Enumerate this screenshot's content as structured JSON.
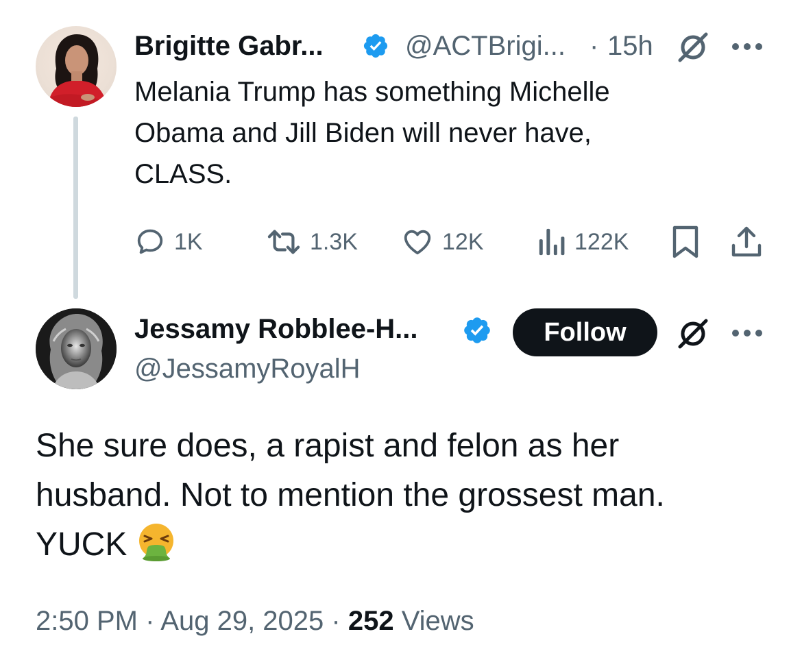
{
  "parent_tweet": {
    "author_name": "Brigitte Gabr...",
    "handle": "@ACTBrigi...",
    "separator": "·",
    "time": "15h",
    "text_lines": [
      "Melania Trump has something Michelle",
      "Obama and Jill Biden will never have,",
      "CLASS."
    ],
    "actions": {
      "replies": "1K",
      "reposts": "1.3K",
      "likes": "12K",
      "views": "122K"
    }
  },
  "reply": {
    "author_name": "Jessamy Robblee-H...",
    "handle": "@JessamyRoyalH",
    "follow_label": "Follow",
    "text_lines": [
      "She sure does, a rapist and felon as her",
      "husband. Not to mention the grossest man.",
      "YUCK"
    ],
    "emoji_icon": "vomiting-face-icon",
    "timestamp": "2:50 PM · Aug 29, 2025 · ",
    "views_count": "252",
    "views_label": " Views"
  },
  "colors": {
    "verified_blue": "#1d9bf0",
    "secondary_text": "#536471",
    "primary_text": "#0f1419",
    "thread_line": "#cfd9de",
    "button_bg": "#0f1419"
  }
}
